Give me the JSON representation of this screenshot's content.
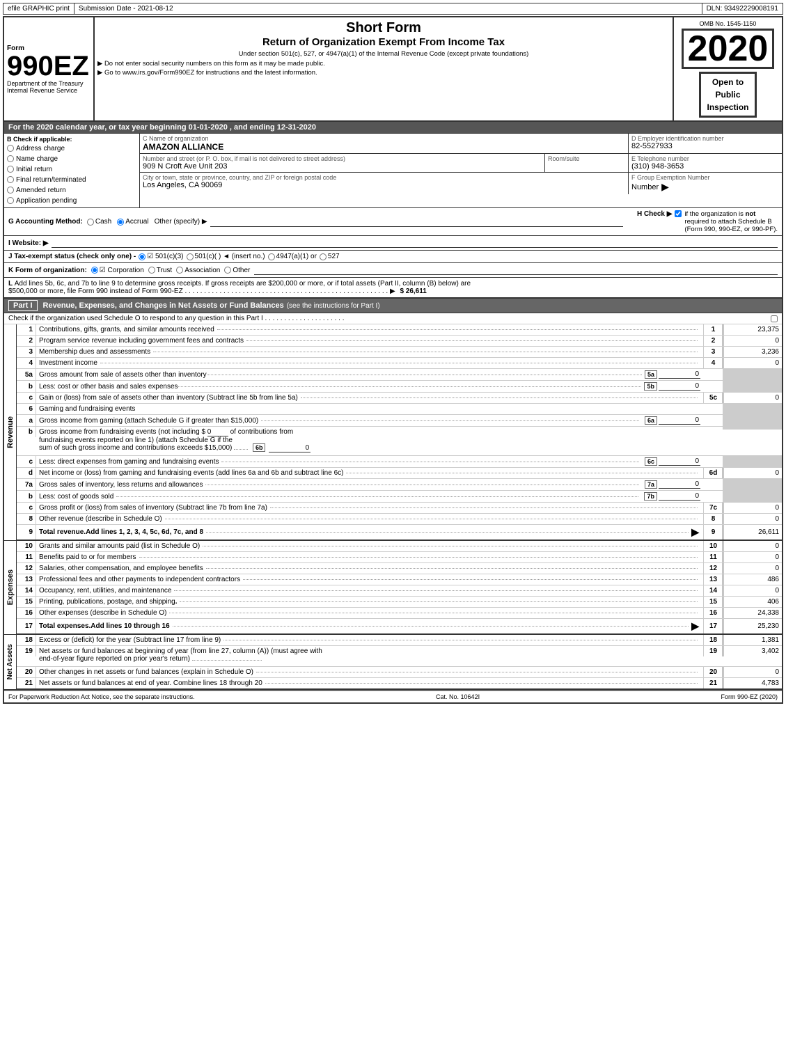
{
  "topBar": {
    "efile": "efile GRAPHIC print",
    "submission": "Submission Date - 2021-08-12",
    "dln": "DLN: 93492229008191"
  },
  "formHeader": {
    "department": "Department of the Treasury",
    "internalRevenue": "Internal Revenue Service",
    "formNumber": "990EZ",
    "formLabel": "Form",
    "shortFormTitle": "Short Form",
    "returnTitle": "Return of Organization Exempt From Income Tax",
    "subtitle": "Under section 501(c), 527, or 4947(a)(1) of the Internal Revenue Code (except private foundations)",
    "ssn_warning": "▶ Do not enter social security numbers on this form as it may be made public.",
    "irs_link": "▶ Go to www.irs.gov/Form990EZ for instructions and the latest information.",
    "year": "2020",
    "omb": "OMB No. 1545-1150",
    "openToPublic": "Open to\nPublic\nInspection"
  },
  "taxYear": {
    "label": "For the 2020 calendar year, or tax year beginning 01-01-2020 , and ending 12-31-2020"
  },
  "checkApplicable": {
    "label": "B Check if applicable:",
    "items": [
      {
        "id": "address_change",
        "label": "Address charge"
      },
      {
        "id": "name_change",
        "label": "Name charge"
      },
      {
        "id": "initial_return",
        "label": "Initial return"
      },
      {
        "id": "final_return",
        "label": "Final return/terminated"
      },
      {
        "id": "amended_return",
        "label": "Amended return"
      },
      {
        "id": "application_pending",
        "label": "Application pending"
      }
    ]
  },
  "orgInfo": {
    "nameLabel": "C Name of organization",
    "name": "AMAZON ALLIANCE",
    "streetLabel": "Number and street (or P. O. box, if mail is not delivered to street address)",
    "street": "909 N Croft Ave Unit 203",
    "roomLabel": "Room/suite",
    "room": "",
    "cityLabel": "City or town, state or province, country, and ZIP or foreign postal code",
    "city": "Los Angeles, CA  90069",
    "employerLabel": "D Employer identification number",
    "employerId": "82-5527933",
    "phoneLabel": "E Telephone number",
    "phone": "(310) 948-3653",
    "groupExemptLabel": "F Group Exemption Number",
    "groupExempt": ""
  },
  "accountingMethod": {
    "label": "G Accounting Method:",
    "cash": "Cash",
    "accrual": "Accrual",
    "other": "Other (specify) ▶",
    "accrualChecked": true
  },
  "hCheck": {
    "label": "H Check ▶",
    "checked": true,
    "description": "if the organization is not required to attach Schedule B (Form 990, 990-EZ, or 990-PF)."
  },
  "website": {
    "label": "I Website: ▶",
    "value": ""
  },
  "taxExempt": {
    "label": "J Tax-exempt status (check only one) -",
    "options": [
      {
        "id": "501c3",
        "label": "501(c)(3)",
        "checked": true
      },
      {
        "id": "501c",
        "label": "501(c)(",
        "suffix": " ) ◄ (insert no.)"
      },
      {
        "id": "4947a1",
        "label": "4947(a)(1) or"
      },
      {
        "id": "527",
        "label": "527"
      }
    ]
  },
  "formOrg": {
    "label": "K Form of organization:",
    "options": [
      {
        "id": "corporation",
        "label": "Corporation",
        "checked": true
      },
      {
        "id": "trust",
        "label": "Trust"
      },
      {
        "id": "association",
        "label": "Association"
      },
      {
        "id": "other",
        "label": "Other"
      }
    ]
  },
  "lRow": {
    "text": "L Add lines 5b, 6c, and 7b to line 9 to determine gross receipts. If gross receipts are $200,000 or more, or if total assets (Part II, column (B) below) are $500,000 or more, file Form 990 instead of Form 990-EZ . . . . . . . . . . . . . . . . . . . . . . . . . . . . . . . . . ▶",
    "amount": "$ 26,611"
  },
  "partI": {
    "header": "Part I",
    "title": "Revenue, Expenses, and Changes in Net Assets or Fund Balances",
    "titleSuffix": "(see the instructions for Part I)",
    "checkLine": "Check if the organization used Schedule O to respond to any question in this Part I . . . . . . . . . . . . . . . . . . . . .",
    "lines": [
      {
        "num": "1",
        "desc": "Contributions, gifts, grants, and similar amounts received",
        "ref": "1",
        "amount": "23,375"
      },
      {
        "num": "2",
        "desc": "Program service revenue including government fees and contracts",
        "ref": "2",
        "amount": "0"
      },
      {
        "num": "3",
        "desc": "Membership dues and assessments",
        "ref": "3",
        "amount": "3,236"
      },
      {
        "num": "4",
        "desc": "Investment income",
        "ref": "4",
        "amount": "0"
      },
      {
        "num": "5a",
        "desc": "Gross amount from sale of assets other than inventory",
        "subRef": "5a",
        "subAmt": "0"
      },
      {
        "num": "5b",
        "desc": "Less: cost or other basis and sales expenses",
        "subRef": "5b",
        "subAmt": "0"
      },
      {
        "num": "5c",
        "desc": "Gain or (loss) from sale of assets other than inventory (Subtract line 5b from line 5a)",
        "ref": "5c",
        "amount": "0"
      },
      {
        "num": "6",
        "desc": "Gaming and fundraising events"
      },
      {
        "num": "6a",
        "desc": "Gross income from gaming (attach Schedule G if greater than $15,000)",
        "subRef": "6a",
        "subAmt": "0"
      },
      {
        "num": "6b",
        "desc": "Gross income from fundraising events (not including $",
        "descExtra": "0",
        "descExtra2": "of contributions from fundraising events reported on line 1) (attach Schedule G if the sum of such gross income and contributions exceeds $15,000)",
        "subRef": "6b",
        "subAmt": "0"
      },
      {
        "num": "6c",
        "desc": "Less: direct expenses from gaming and fundraising events",
        "subRef": "6c",
        "subAmt": "0"
      },
      {
        "num": "6d",
        "desc": "Net income or (loss) from gaming and fundraising events (add lines 6a and 6b and subtract line 6c)",
        "ref": "6d",
        "amount": "0"
      },
      {
        "num": "7a",
        "desc": "Gross sales of inventory, less returns and allowances",
        "subRef": "7a",
        "subAmt": "0"
      },
      {
        "num": "7b",
        "desc": "Less: cost of goods sold",
        "subRef": "7b",
        "subAmt": "0"
      },
      {
        "num": "7c",
        "desc": "Gross profit or (loss) from sales of inventory (Subtract line 7b from line 7a)",
        "ref": "7c",
        "amount": "0"
      },
      {
        "num": "8",
        "desc": "Other revenue (describe in Schedule O)",
        "ref": "8",
        "amount": "0"
      },
      {
        "num": "9",
        "desc": "Total revenue. Add lines 1, 2, 3, 4, 5c, 6d, 7c, and 8",
        "ref": "9",
        "amount": "26,611",
        "bold": true
      }
    ]
  },
  "expenses": {
    "lines": [
      {
        "num": "10",
        "desc": "Grants and similar amounts paid (list in Schedule O)",
        "ref": "10",
        "amount": "0"
      },
      {
        "num": "11",
        "desc": "Benefits paid to or for members",
        "ref": "11",
        "amount": "0"
      },
      {
        "num": "12",
        "desc": "Salaries, other compensation, and employee benefits",
        "ref": "12",
        "amount": "0"
      },
      {
        "num": "13",
        "desc": "Professional fees and other payments to independent contractors",
        "ref": "13",
        "amount": "486"
      },
      {
        "num": "14",
        "desc": "Occupancy, rent, utilities, and maintenance",
        "ref": "14",
        "amount": "0"
      },
      {
        "num": "15",
        "desc": "Printing, publications, postage, and shipping",
        "ref": "15",
        "amount": "406"
      },
      {
        "num": "16",
        "desc": "Other expenses (describe in Schedule O)",
        "ref": "16",
        "amount": "24,338"
      },
      {
        "num": "17",
        "desc": "Total expenses. Add lines 10 through 16",
        "ref": "17",
        "amount": "25,230",
        "bold": true
      }
    ]
  },
  "netAssets": {
    "lines": [
      {
        "num": "18",
        "desc": "Excess or (deficit) for the year (Subtract line 17 from line 9)",
        "ref": "18",
        "amount": "1,381"
      },
      {
        "num": "19",
        "desc": "Net assets or fund balances at beginning of year (from line 27, column (A)) (must agree with end-of-year figure reported on prior year's return)",
        "ref": "19",
        "amount": "3,402"
      },
      {
        "num": "20",
        "desc": "Other changes in net assets or fund balances (explain in Schedule O)",
        "ref": "20",
        "amount": "0"
      },
      {
        "num": "21",
        "desc": "Net assets or fund balances at end of year. Combine lines 18 through 20",
        "ref": "21",
        "amount": "4,783"
      }
    ]
  },
  "footer": {
    "paperwork": "For Paperwork Reduction Act Notice, see the separate instructions.",
    "catNo": "Cat. No. 10642I",
    "formRef": "Form 990-EZ (2020)"
  }
}
